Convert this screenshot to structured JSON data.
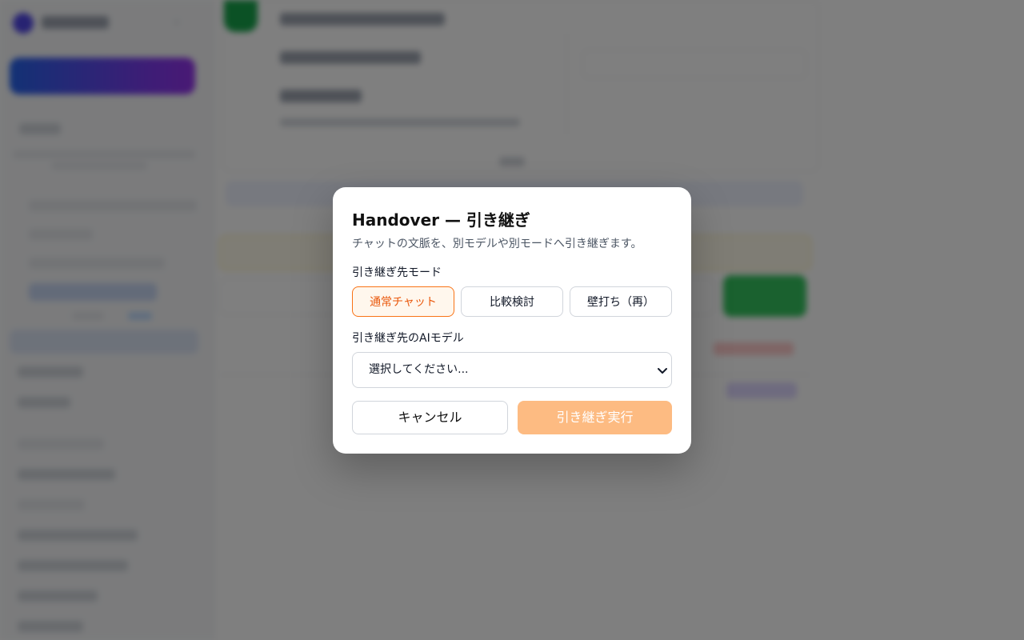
{
  "modal": {
    "title": "Handover — 引き継ぎ",
    "subtitle": "チャットの文脈を、別モデルや別モードへ引き継ぎます。",
    "mode_label": "引き継ぎ先モード",
    "modes": [
      {
        "label": "通常チャット",
        "selected": true
      },
      {
        "label": "比較検討",
        "selected": false
      },
      {
        "label": "壁打ち（再）",
        "selected": false
      }
    ],
    "model_label": "引き継ぎ先のAIモデル",
    "model_select": {
      "value": "選択してください..."
    },
    "cancel_label": "キャンセル",
    "execute_label": "引き継ぎ実行",
    "execute_enabled": false
  },
  "colors": {
    "accent": "#f97316",
    "accent_bg": "#fff7ed",
    "execute_disabled": "#fdbb82",
    "overlay": "rgba(0,0,0,0.5)"
  },
  "icons": {
    "select_chevron": "chevron-down-icon"
  }
}
